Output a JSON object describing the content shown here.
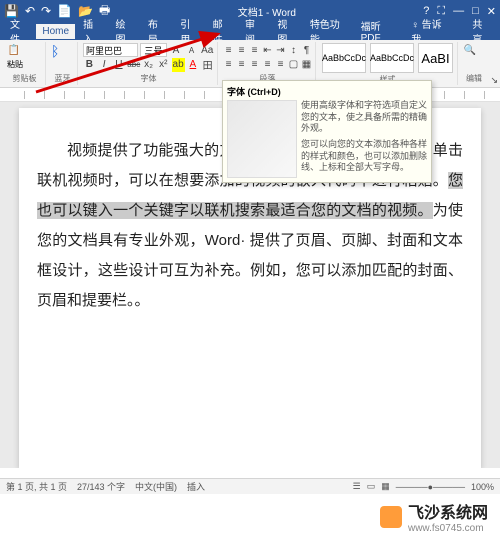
{
  "title": "文档1 - Word",
  "qat": {
    "save": "💾",
    "undo": "↶",
    "redo": "↷",
    "new": "📄",
    "open": "📂",
    "print": "🖶"
  },
  "winbtns": {
    "min": "—",
    "max": "□",
    "close": "✕",
    "help": "?",
    "opts": "⛶"
  },
  "tabs": {
    "file": "文件",
    "home": "Home",
    "insert": "插入",
    "draw": "绘图",
    "layout": "布局",
    "ref": "引用",
    "mail": "邮件",
    "review": "审阅",
    "view": "视图",
    "te": "特色功能",
    "fuxin": "福昕PDF",
    "tell": "♀ 告诉我...",
    "share": "共享"
  },
  "clipboard": {
    "paste": "粘贴",
    "label": "剪贴板",
    "fmt": "📋",
    "bt": "蓝牙"
  },
  "font": {
    "name": "阿里巴巴普...",
    "size": "三号",
    "grow": "A",
    "shrink": "A",
    "bold": "B",
    "italic": "I",
    "under": "U",
    "strike": "abc",
    "sub": "x₂",
    "sup": "x²",
    "clr": "A",
    "hl": "ab",
    "clear": "⌫",
    "phon": "Aa",
    "border": "田",
    "label": "字体"
  },
  "para_grp": {
    "bul": "≡",
    "num": "≡",
    "ml": "≡",
    "dec": "⇤",
    "inc": "⇥",
    "sort": "↕",
    "show": "¶",
    "al": "≡",
    "ac": "≡",
    "ar": "≡",
    "aj": "≡",
    "ls": "≡",
    "shade": "▢",
    "brd": "▦",
    "label": "段落"
  },
  "styles": {
    "s1": "AaBbCcDc",
    "s2": "AaBbCcDc",
    "s3": "AaBI",
    "label": "样式"
  },
  "edit": {
    "find": "🔍",
    "repl": "↻",
    "sel": "☰",
    "label": "编辑"
  },
  "tooltip": {
    "title": "字体 (Ctrl+D)",
    "p1": "使用高级字体和字符选项自定义您的文本，使之具备所需的精确外观。",
    "p2": "您可以向您的文本添加各种各样的样式和颜色，也可以添加删除线、上标和全部大写字母。"
  },
  "body": {
    "pre": "视频提供了功能强大的方法帮助您证明您的观点。当您单击联机视频时，可以在想要添加的视频的嵌入代码中进行粘贴。",
    "hl": "您也可以键入一个关键字以联机搜索最适合您的文档的视频。",
    "post": "为使您的文档具有专业外观，Word· 提供了页眉、页脚、封面和文本框设计，这些设计可互为补充。例如，您可以添加匹配的封面、页眉和提要栏。。"
  },
  "status": {
    "page": "第 1 页, 共 1 页",
    "words": "27/143 个字",
    "lang": "中文(中国)",
    "ins": "插入",
    "views": {
      "read": "☰",
      "print": "▭",
      "web": "▦"
    },
    "zoom": "100%",
    "slider": "—"
  },
  "watermark": {
    "brand": "飞沙系统网",
    "url": "www.fs0745.com"
  }
}
